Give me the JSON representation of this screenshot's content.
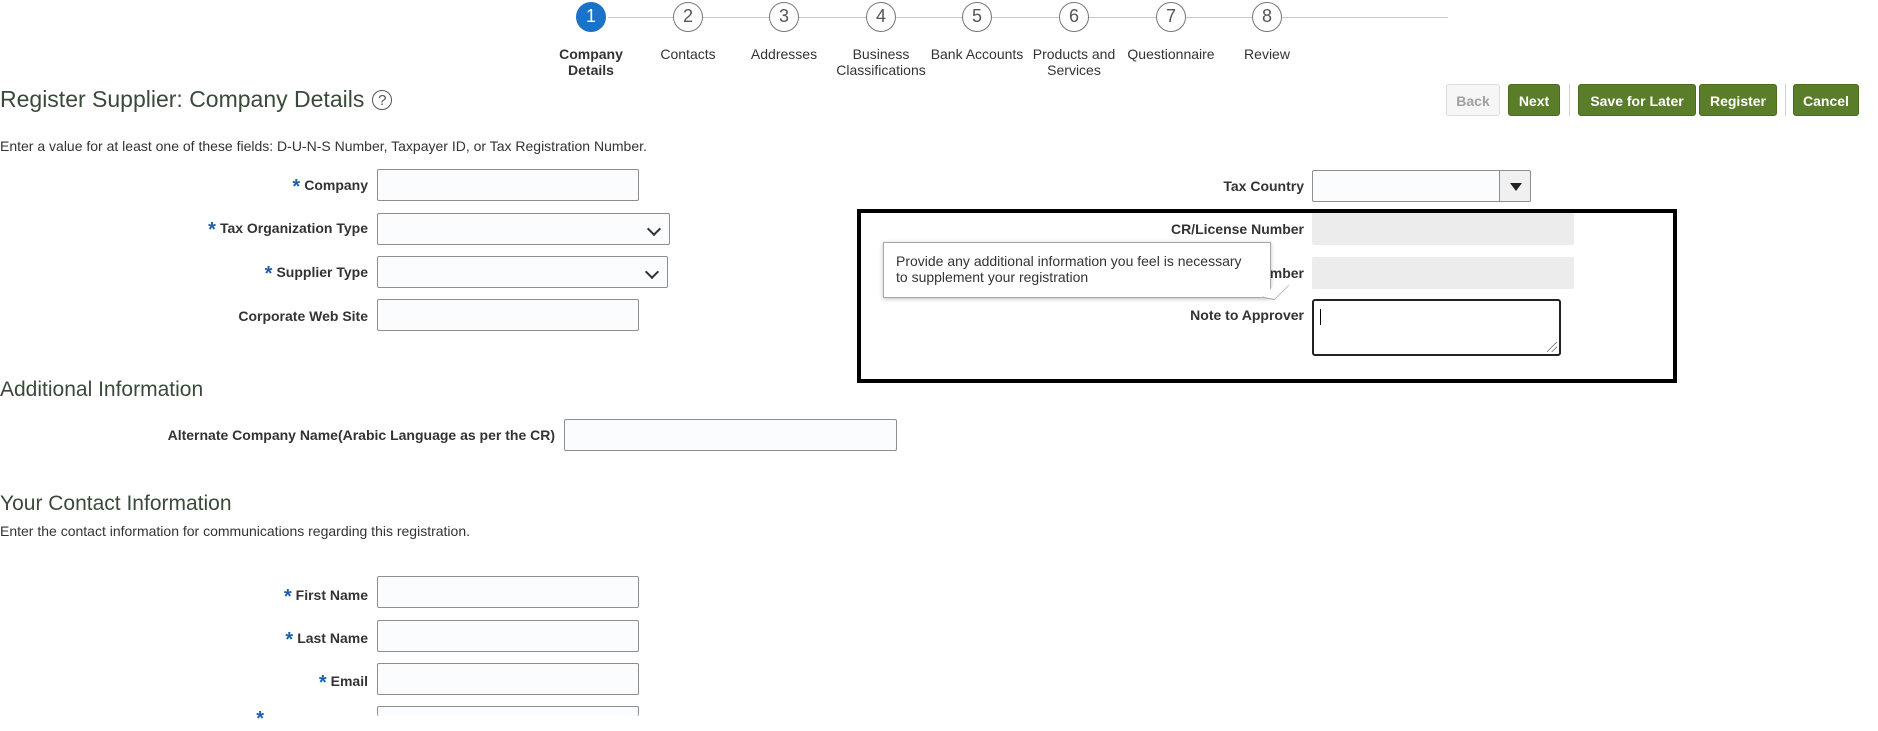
{
  "train": {
    "steps": [
      {
        "number": "1",
        "label_lines": [
          "Company",
          "Details"
        ],
        "active": true
      },
      {
        "number": "2",
        "label_lines": [
          "Contacts",
          ""
        ],
        "active": false
      },
      {
        "number": "3",
        "label_lines": [
          "Addresses",
          ""
        ],
        "active": false
      },
      {
        "number": "4",
        "label_lines": [
          "Business",
          "Classifications"
        ],
        "active": false
      },
      {
        "number": "5",
        "label_lines": [
          "Bank Accounts",
          ""
        ],
        "active": false
      },
      {
        "number": "6",
        "label_lines": [
          "Products and",
          "Services"
        ],
        "active": false
      },
      {
        "number": "7",
        "label_lines": [
          "Questionnaire",
          ""
        ],
        "active": false
      },
      {
        "number": "8",
        "label_lines": [
          "Review",
          ""
        ],
        "active": false
      }
    ]
  },
  "page": {
    "title": "Register Supplier: Company Details",
    "help_glyph": "?",
    "instruction": "Enter a value for at least one of these fields: D-U-N-S Number, Taxpayer ID, or Tax Registration Number."
  },
  "toolbar": {
    "back_label": "Back",
    "next_label": "Next",
    "save_later_label": "Save for Later",
    "register_label": "Register",
    "cancel_label": "Cancel"
  },
  "form_left": {
    "required_marker": "*",
    "company_label": "Company",
    "tax_org_type_label": "Tax Organization Type",
    "supplier_type_label": "Supplier Type",
    "website_label": "Corporate Web Site"
  },
  "form_right": {
    "tax_country_label": "Tax Country",
    "cr_license_label": "CR/License Number",
    "hidden_number_label_fragment": "mber",
    "note_label": "Note to Approver"
  },
  "tooltip": {
    "line1": "Provide any additional information you feel is necessary",
    "line2": "to supplement your registration"
  },
  "additional": {
    "title": "Additional Information",
    "alt_name_label": "Alternate Company Name(Arabic Language as per the CR)"
  },
  "contact": {
    "title": "Your Contact Information",
    "instruction": "Enter the contact information for communications regarding this registration.",
    "first_name_label": "First Name",
    "last_name_label": "Last Name",
    "email_label": "Email"
  },
  "colors": {
    "accent_blue": "#1a73c9",
    "button_green": "#5a7d2a",
    "required_blue": "#1a5fa8"
  }
}
